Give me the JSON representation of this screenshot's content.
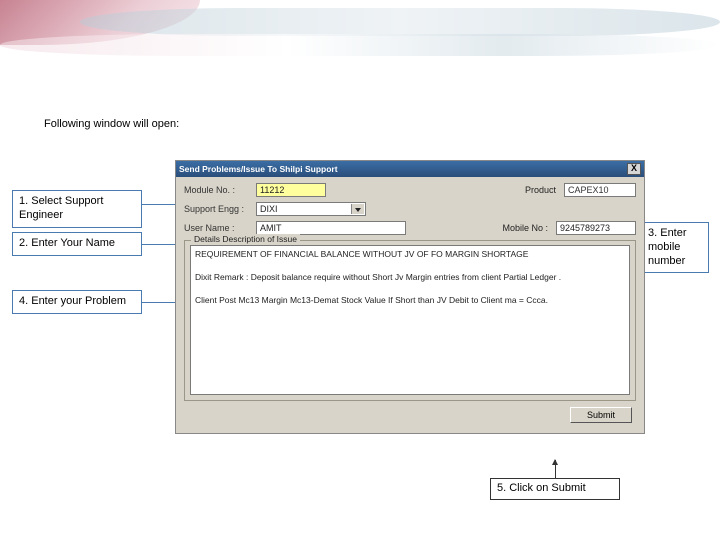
{
  "banner": {
    "present": true
  },
  "intro": "Following window will open:",
  "callouts": {
    "c1": "1. Select Support Engineer",
    "c2": "2. Enter Your Name",
    "c3": "3. Enter mobile number",
    "c4": "4. Enter your Problem",
    "c5": "5. Click on Submit"
  },
  "window": {
    "title": "Send Problems/Issue To Shilpi Support",
    "close_glyph": "X",
    "labels": {
      "module": "Module No. :",
      "product": "Product",
      "support": "Support Engg :",
      "username": "User Name :",
      "mobile": "Mobile No :",
      "group": "Details Description of Issue",
      "submit": "Submit"
    },
    "values": {
      "module": "11212",
      "product": "CAPEX10",
      "support": "DIXI",
      "username": "AMIT",
      "mobile": "9245789273",
      "issue_line1": "REQUIREMENT OF FINANCIAL BALANCE WITHOUT JV OF FO MARGIN SHORTAGE",
      "issue_line2": "Dixit Remark : Deposit balance require without Short Jv Margin entries from client Partial Ledger .",
      "issue_line3": "Client Post Mc13 Margin Mc13-Demat Stock Value If Short than JV Debit to Client ma = Ccca."
    }
  },
  "colors": {
    "callout_border": "#4a7bb0",
    "titlebar": "#2a4e7a",
    "panel": "#d8d4c9",
    "highlight": "#ffff9e"
  }
}
